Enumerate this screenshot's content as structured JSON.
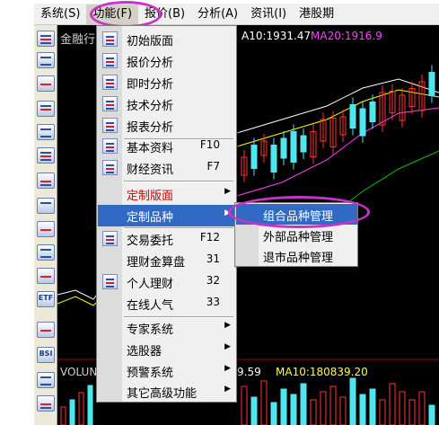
{
  "menubar": {
    "items": [
      "系统(S)",
      "功能(F)",
      "报价(B)",
      "分析(A)",
      "资讯(I)",
      "港股期"
    ]
  },
  "chart": {
    "stock_name": "金融行",
    "ma10_label": "A10:1931.47",
    "ma20_label": "MA20:1916.9",
    "volume_label": "VOLUN",
    "volume_value": "9.59",
    "volume_ma10_label": "MA10:180839.20",
    "colors": {
      "up": "#ff3232",
      "down": "#50e6f0",
      "ma_white": "#ffffff",
      "ma_yellow": "#ffff00",
      "ma_magenta": "#ff40ff",
      "ma_green": "#00c800"
    }
  },
  "function_menu": {
    "items": [
      {
        "label": "初始版面",
        "shortcut": "",
        "icon": "layout-icon"
      },
      {
        "label": "报价分析",
        "shortcut": "",
        "icon": "quote-grid-icon"
      },
      {
        "label": "即时分析",
        "shortcut": "",
        "icon": "realtime-chart-icon"
      },
      {
        "label": "技术分析",
        "shortcut": "",
        "icon": "candlestick-icon"
      },
      {
        "label": "报表分析",
        "shortcut": "",
        "icon": "report-icon"
      },
      {
        "label": "基本资料",
        "shortcut": "F10",
        "icon": "basic-info-icon"
      },
      {
        "label": "财经资讯",
        "shortcut": "F7",
        "icon": "news-icon"
      },
      {
        "label": "定制版面",
        "shortcut": "",
        "icon": ""
      },
      {
        "label": "定制品种",
        "shortcut": "",
        "icon": ""
      },
      {
        "label": "交易委托",
        "shortcut": "F12",
        "icon": "trade-icon"
      },
      {
        "label": "理财金算盘",
        "shortcut": "31",
        "icon": ""
      },
      {
        "label": "个人理财",
        "shortcut": "32",
        "icon": "finance-icon"
      },
      {
        "label": "在线人气",
        "shortcut": "33",
        "icon": ""
      },
      {
        "label": "专家系统",
        "shortcut": "",
        "icon": ""
      },
      {
        "label": "选股器",
        "shortcut": "",
        "icon": ""
      },
      {
        "label": "预警系统",
        "shortcut": "",
        "icon": ""
      },
      {
        "label": "其它高级功能",
        "shortcut": "",
        "icon": ""
      }
    ]
  },
  "submenu": {
    "items": [
      "组合品种管理",
      "外部品种管理",
      "退市品种管理"
    ]
  },
  "toolbar": {
    "labels": [
      "ETF",
      "BSI"
    ]
  }
}
